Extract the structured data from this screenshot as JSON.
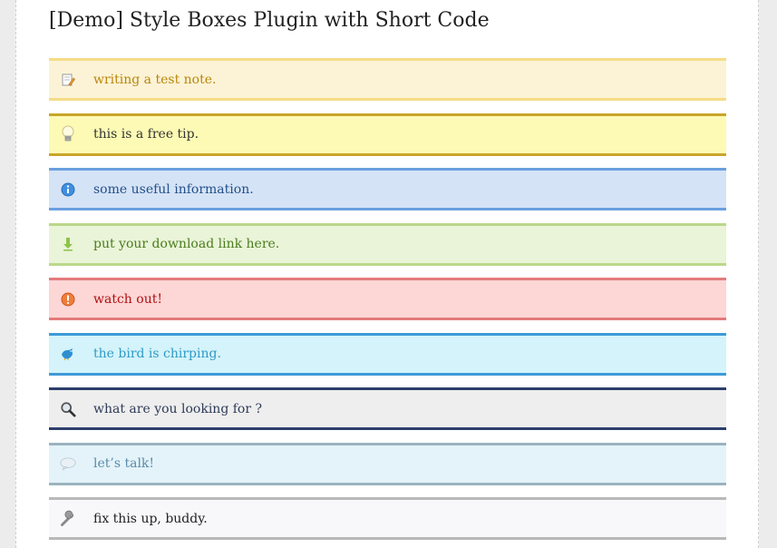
{
  "page": {
    "title": "[Demo] Style Boxes Plugin with Short Code"
  },
  "boxes": [
    {
      "type": "note",
      "icon": "pencil-note-icon",
      "text": "writing a test note."
    },
    {
      "type": "tip",
      "icon": "lightbulb-icon",
      "text": "this is a free tip."
    },
    {
      "type": "info",
      "icon": "info-icon",
      "text": "some useful information."
    },
    {
      "type": "download",
      "icon": "download-arrow-icon",
      "text": "put your download link here."
    },
    {
      "type": "warning",
      "icon": "warning-icon",
      "text": "watch out!"
    },
    {
      "type": "twitter",
      "icon": "bird-icon",
      "text": "the bird is chirping."
    },
    {
      "type": "search",
      "icon": "magnifier-icon",
      "text": "what are you looking for ?"
    },
    {
      "type": "talk",
      "icon": "speech-bubble-icon",
      "text": "let’s talk!"
    },
    {
      "type": "tool",
      "icon": "wrench-icon",
      "text": "fix this up, buddy."
    }
  ],
  "colors": {
    "note_bg": "#fcf3d6",
    "tip_bg": "#fcfab4",
    "info_bg": "#d5e3f6",
    "download_bg": "#eaf4d8",
    "warning_bg": "#fdd6d6",
    "twitter_bg": "#d4f3fa",
    "search_bg": "#eeeeee",
    "talk_bg": "#e4f3fa",
    "tool_bg": "#f8f8fb"
  }
}
